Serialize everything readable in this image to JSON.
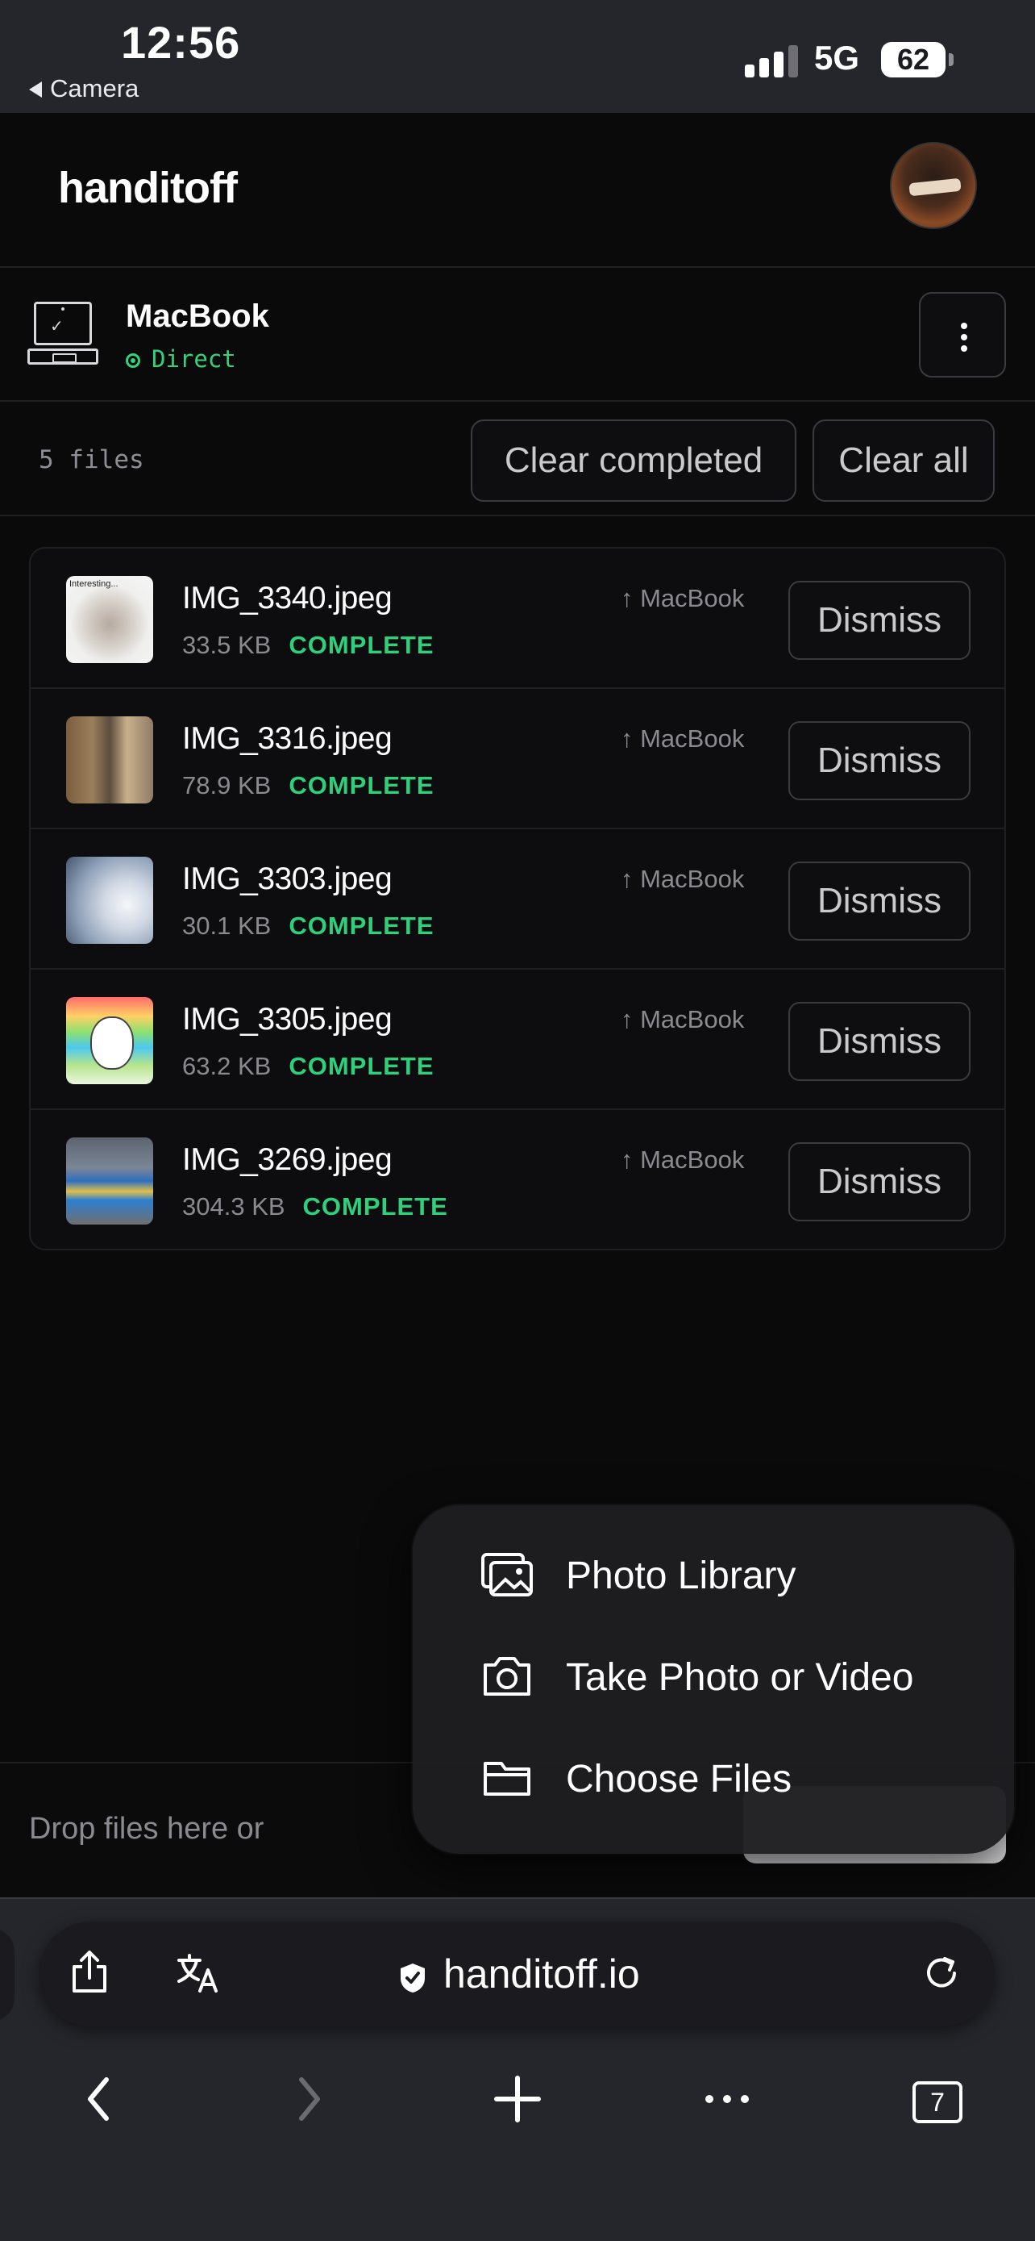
{
  "status_bar": {
    "time": "12:56",
    "back_label": "Camera",
    "network": "5G",
    "battery": "62"
  },
  "app": {
    "logo": "handitoff"
  },
  "device": {
    "name": "MacBook",
    "connection": "Direct"
  },
  "toolbar": {
    "file_count": "5 files",
    "clear_completed": "Clear completed",
    "clear_all": "Clear all"
  },
  "files": [
    {
      "name": "IMG_3340.jpeg",
      "size": "33.5 KB",
      "status": "COMPLETE",
      "dest": "↑ MacBook",
      "dismiss": "Dismiss",
      "thumb_caption": "Interesting..."
    },
    {
      "name": "IMG_3316.jpeg",
      "size": "78.9 KB",
      "status": "COMPLETE",
      "dest": "↑ MacBook",
      "dismiss": "Dismiss"
    },
    {
      "name": "IMG_3303.jpeg",
      "size": "30.1 KB",
      "status": "COMPLETE",
      "dest": "↑ MacBook",
      "dismiss": "Dismiss"
    },
    {
      "name": "IMG_3305.jpeg",
      "size": "63.2 KB",
      "status": "COMPLETE",
      "dest": "↑ MacBook",
      "dismiss": "Dismiss"
    },
    {
      "name": "IMG_3269.jpeg",
      "size": "304.3 KB",
      "status": "COMPLETE",
      "dest": "↑ MacBook",
      "dismiss": "Dismiss"
    }
  ],
  "dropzone": {
    "text": "Drop files here or"
  },
  "picker_menu": {
    "items": [
      {
        "label": "Photo Library",
        "icon": "photo-library-icon"
      },
      {
        "label": "Take Photo or Video",
        "icon": "camera-icon"
      },
      {
        "label": "Choose Files",
        "icon": "folder-icon"
      }
    ]
  },
  "browser": {
    "url": "handitoff.io",
    "tab_count": "7"
  },
  "colors": {
    "accent_green": "#2fd07c",
    "background": "#0a0a0b",
    "browser_chrome": "#25262b"
  }
}
